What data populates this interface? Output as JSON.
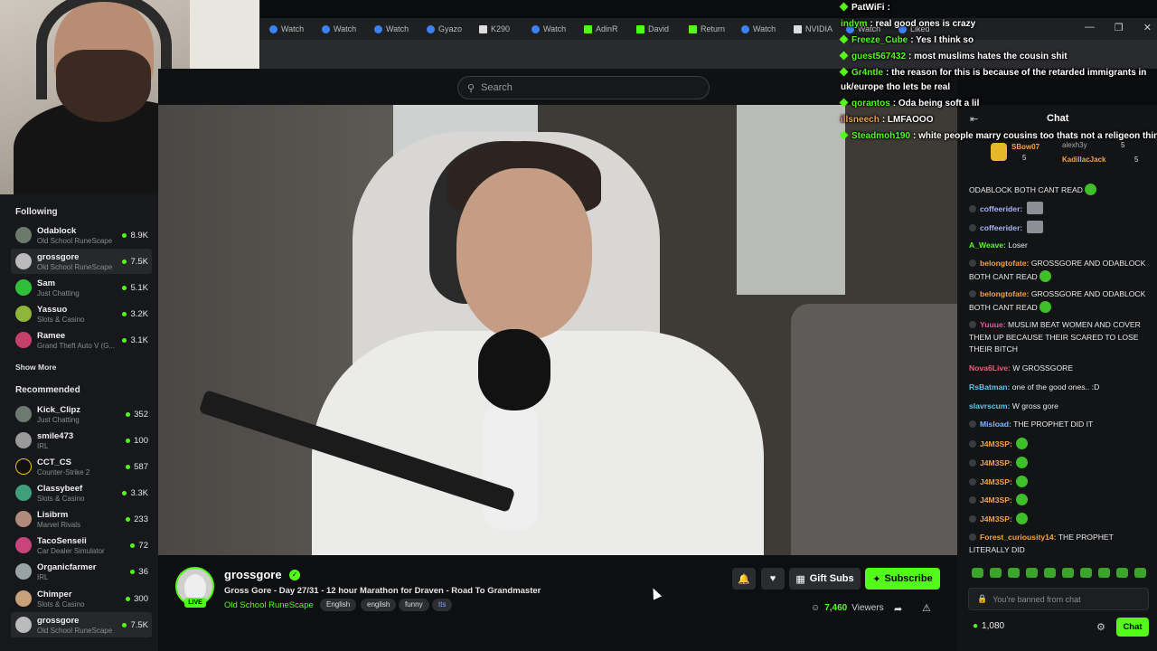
{
  "browser": {
    "tabs": [
      "Watch",
      "Watch",
      "Watch",
      "Gyazo",
      "K290",
      "Watch",
      "AdinR",
      "David",
      "Return",
      "Watch",
      "NVIDIA",
      "Watch",
      "Liked"
    ],
    "window_controls": [
      "—",
      "❐",
      "✕"
    ]
  },
  "header": {
    "search_placeholder": "Search"
  },
  "sidebar": {
    "following_title": "Following",
    "following": [
      {
        "name": "Odablock",
        "game": "Old School RuneScape",
        "viewers": "8.9K"
      },
      {
        "name": "grossgore",
        "game": "Old School RuneScape",
        "viewers": "7.5K"
      },
      {
        "name": "Sam",
        "game": "Just Chatting",
        "viewers": "5.1K"
      },
      {
        "name": "Yassuo",
        "game": "Slots & Casino",
        "viewers": "3.2K"
      },
      {
        "name": "Ramee",
        "game": "Grand Theft Auto V (G...",
        "viewers": "3.1K"
      }
    ],
    "show_more": "Show More",
    "recommended_title": "Recommended",
    "recommended": [
      {
        "name": "Kick_Clipz",
        "game": "Just Chatting",
        "viewers": "352"
      },
      {
        "name": "smile473",
        "game": "IRL",
        "viewers": "100"
      },
      {
        "name": "CCT_CS",
        "game": "Counter-Strike 2",
        "viewers": "587"
      },
      {
        "name": "Classybeef",
        "game": "Slots & Casino",
        "viewers": "3.3K"
      },
      {
        "name": "Lisibrm",
        "game": "Marvel Rivals",
        "viewers": "233"
      },
      {
        "name": "TacoSenseii",
        "game": "Car Dealer Simulator",
        "viewers": "72"
      },
      {
        "name": "Organicfarmer",
        "game": "IRL",
        "viewers": "36"
      },
      {
        "name": "Chimper",
        "game": "Slots & Casino",
        "viewers": "300"
      },
      {
        "name": "grossgore",
        "game": "Old School RuneScape",
        "viewers": "7.5K"
      }
    ]
  },
  "stream": {
    "streamer": "grossgore",
    "live_label": "LIVE",
    "title": "Gross Gore - Day 27/31 - 12 hour Marathon for Draven - Road To Grandmaster",
    "category": "Old School RuneScape",
    "tags": [
      "English",
      "english",
      "funny",
      "tts"
    ],
    "gift_label": "Gift Subs",
    "subscribe_label": "Subscribe",
    "viewer_count": "7,460",
    "viewer_suffix": "Viewers"
  },
  "overlay_chat": [
    {
      "user": "PatWiFi",
      "text": ":",
      "color": "#ffffff"
    },
    {
      "user": "indym",
      "text": ": real good ones is crazy",
      "color": "#53fc18"
    },
    {
      "user": "Freeze_Cube",
      "text": ": Yes I think so",
      "color": "#53fc18"
    },
    {
      "user": "guest567432",
      "text": ": most muslims hates the cousin shit",
      "color": "#53fc18"
    },
    {
      "user": "Gr4ntle",
      "text": ": the reason for this is because of the retarded immigrants in",
      "color": "#53fc18"
    },
    {
      "user": "",
      "text": "uk/europe tho lets be real",
      "color": "#ffffff"
    },
    {
      "user": "qorantos",
      "text": ": Oda being soft a lil",
      "color": "#53fc18"
    },
    {
      "user": "illsneech",
      "text": ": LMFAOOO",
      "color": "#e8a24b"
    },
    {
      "user": "Steadmoh190",
      "text": ": white people marry cousins too thats not a religeon thing",
      "color": "#53fc18"
    }
  ],
  "chat": {
    "title": "Chat",
    "leaders": [
      {
        "name": "SBow07",
        "count": "5"
      },
      {
        "name": "alexh3y",
        "count": "5"
      },
      {
        "name": "KadillacJack",
        "count": "5"
      }
    ],
    "messages": [
      {
        "user": "",
        "text": "ODABLOCK BOTH CANT READ",
        "color": "#ffffff"
      },
      {
        "user": "coffeerider:",
        "text": "",
        "color": "#a5b4fc"
      },
      {
        "user": "coffeerider:",
        "text": "",
        "color": "#a5b4fc"
      },
      {
        "user": "A_Weave:",
        "text": "Loser",
        "color": "#53fc18"
      },
      {
        "user": "belongtofate:",
        "text": "GROSSGORE AND ODABLOCK BOTH CANT READ",
        "color": "#f4a142"
      },
      {
        "user": "belongtofate:",
        "text": "GROSSGORE AND ODABLOCK BOTH CANT READ",
        "color": "#f4a142"
      },
      {
        "user": "Yuuue:",
        "text": "MUSLIM BEAT WOMEN AND COVER THEM UP BECAUSE THEIR SCARED TO LOSE THEIR BITCH",
        "color": "#e05a9a"
      },
      {
        "user": "Nova6Live:",
        "text": "W GROSSGORE",
        "color": "#f05a7a"
      },
      {
        "user": "RsBatman:",
        "text": "one of the good ones.. :D",
        "color": "#5ac8f0"
      },
      {
        "user": "slavrscum:",
        "text": "W gross gore",
        "color": "#5ac8f0"
      },
      {
        "user": "Misload:",
        "text": "THE PROPHET DID IT",
        "color": "#7ab8ff"
      },
      {
        "user": "J4M3SP:",
        "text": "",
        "color": "#f4a142"
      },
      {
        "user": "J4M3SP:",
        "text": "",
        "color": "#f4a142"
      },
      {
        "user": "J4M3SP:",
        "text": "",
        "color": "#f4a142"
      },
      {
        "user": "J4M3SP:",
        "text": "",
        "color": "#f4a142"
      },
      {
        "user": "J4M3SP:",
        "text": "",
        "color": "#f4a142"
      },
      {
        "user": "Forest_curiousity14:",
        "text": "THE PROPHET LITERALLY DID",
        "color": "#f4a142"
      }
    ],
    "input_placeholder": "You're banned from chat",
    "points": "1,080",
    "send_label": "Chat"
  },
  "colors": {
    "accent": "#53fc18",
    "background": "#0b0c0e",
    "panel": "#17181b"
  }
}
